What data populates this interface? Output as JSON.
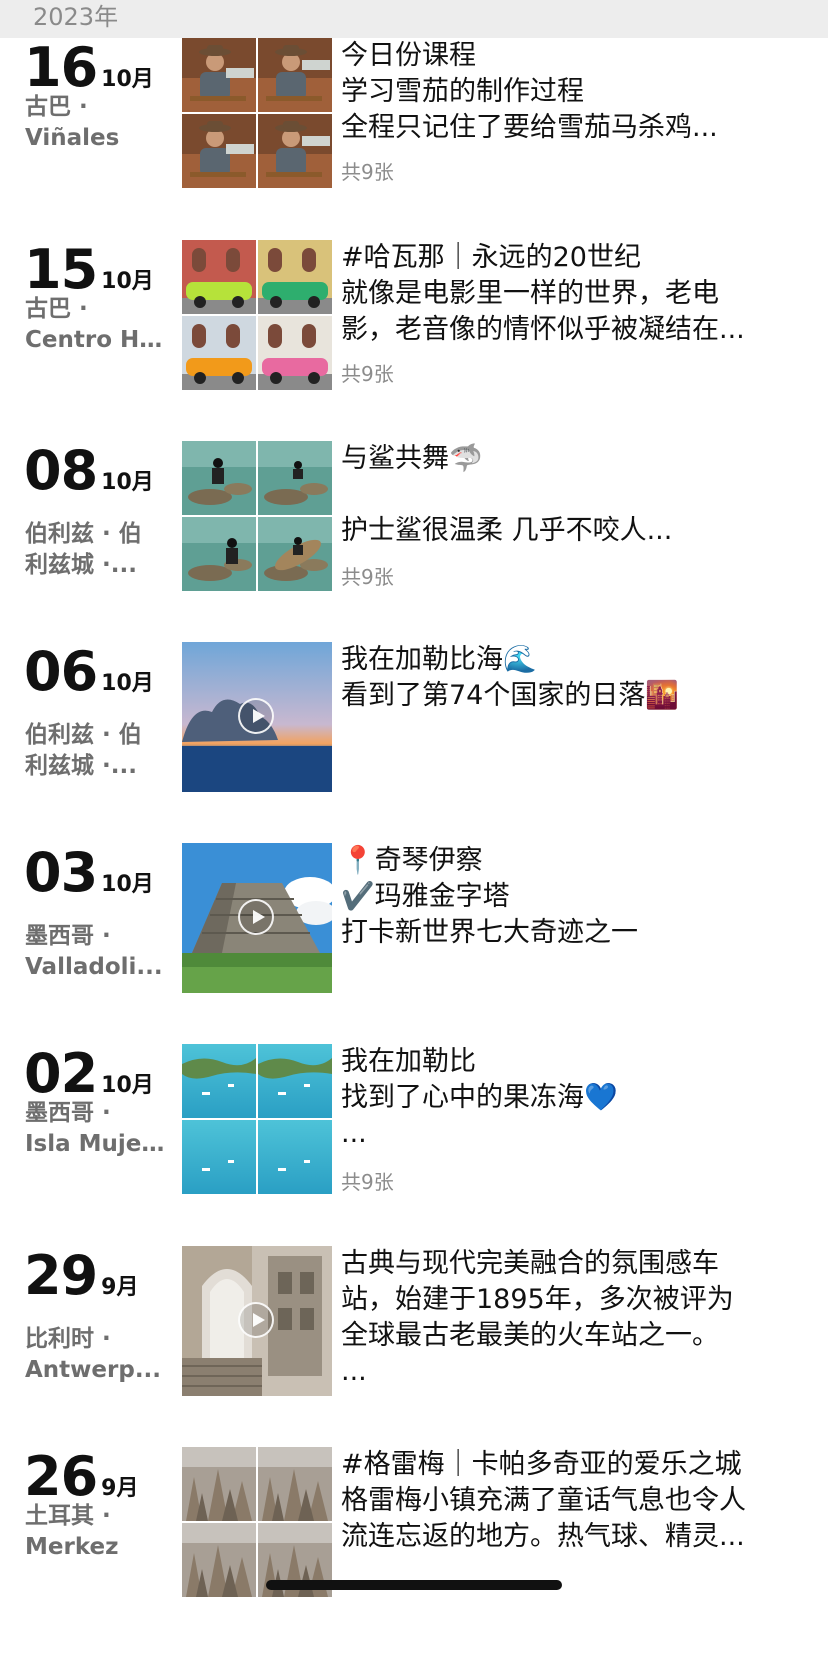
{
  "year": "2023年",
  "entries": [
    {
      "day": "16",
      "month": "10月",
      "loc1": "古巴 ·",
      "loc2": "Viñales",
      "lines": [
        "今日份课程",
        "学习雪茄的制作过程",
        "全程只记住了要给雪茄马杀鸡..."
      ],
      "count": "共9张",
      "media": "grid",
      "theme": "cigar"
    },
    {
      "day": "15",
      "month": "10月",
      "loc1": "古巴 ·",
      "loc2": "Centro H...",
      "lines": [
        "#哈瓦那｜永远的20世纪",
        "就像是电影里一样的世界，老电",
        "影，老音像的情怀似乎被凝结在..."
      ],
      "count": "共9张",
      "media": "grid",
      "theme": "havana"
    },
    {
      "day": "08",
      "month": "10月",
      "loc1": "伯利兹 · 伯",
      "loc2": "利兹城 ·...",
      "lines": [
        "与鲨共舞🦈",
        "",
        "护士鲨很温柔 几乎不咬人..."
      ],
      "count": "共9张",
      "media": "grid",
      "theme": "shark"
    },
    {
      "day": "06",
      "month": "10月",
      "loc1": "伯利兹 · 伯",
      "loc2": "利兹城 ·...",
      "lines": [
        "我在加勒比海🌊",
        "看到了第74个国家的日落🌇"
      ],
      "count": "",
      "media": "video",
      "theme": "sunset"
    },
    {
      "day": "03",
      "month": "10月",
      "loc1": "墨西哥 ·",
      "loc2": "Valladoli...",
      "lines": [
        "📍奇琴伊察",
        "✔️玛雅金字塔",
        "打卡新世界七大奇迹之一"
      ],
      "count": "",
      "media": "video",
      "theme": "pyramid"
    },
    {
      "day": "02",
      "month": "10月",
      "loc1": "墨西哥 ·",
      "loc2": "Isla Muje...",
      "lines": [
        "我在加勒比",
        "找到了心中的果冻海💙",
        "..."
      ],
      "count": "共9张",
      "media": "grid",
      "theme": "jelly"
    },
    {
      "day": "29",
      "month": "9月",
      "loc1": "比利时 ·",
      "loc2": "Antwerp...",
      "lines": [
        "古典与现代完美融合的氛围感车",
        "站，始建于1895年，多次被评为",
        "全球最古老最美的火车站之一。",
        "..."
      ],
      "count": "",
      "media": "video",
      "theme": "station"
    },
    {
      "day": "26",
      "month": "9月",
      "loc1": "土耳其 ·",
      "loc2": "Merkez",
      "lines": [
        "#格雷梅｜卡帕多奇亚的爱乐之城",
        "格雷梅小镇充满了童话气息也令人",
        "流连忘返的地方。热气球、精灵..."
      ],
      "count": "",
      "media": "grid",
      "theme": "cappadocia"
    }
  ]
}
